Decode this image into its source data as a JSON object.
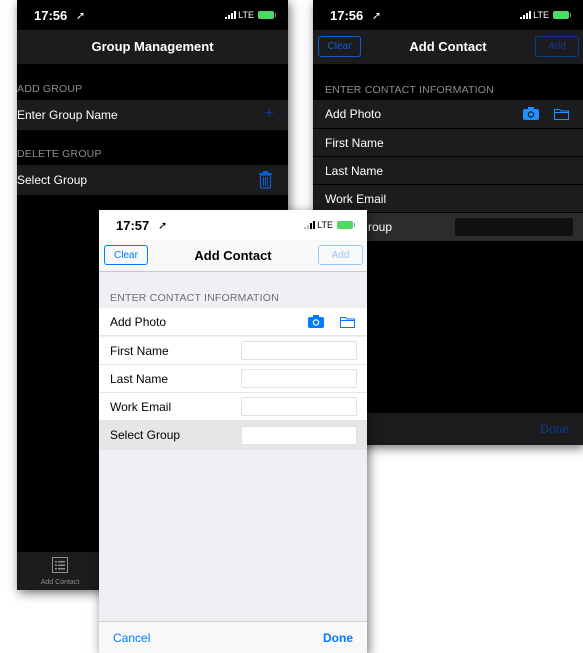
{
  "colors": {
    "accent": "#007aff",
    "dark_bg": "#000000",
    "dark_row": "#1c1c1e",
    "light_bg": "#efeff4"
  },
  "screens": {
    "group_management": {
      "status": {
        "time": "17:56",
        "network": "LTE"
      },
      "title": "Group Management",
      "add_group": {
        "section": "ADD GROUP",
        "placeholder": "Enter Group Name",
        "add_icon": "plus-icon"
      },
      "delete_group": {
        "section": "DELETE GROUP",
        "label": "Select Group",
        "delete_icon": "trash-icon"
      },
      "tab": {
        "label": "Add Contact",
        "icon": "list-icon"
      }
    },
    "add_contact_dark": {
      "status": {
        "time": "17:56",
        "network": "LTE"
      },
      "clear": "Clear",
      "title": "Add Contact",
      "add": "Add",
      "section": "ENTER CONTACT INFORMATION",
      "rows": [
        "Add Photo",
        "First Name",
        "Last Name",
        "Work Email",
        "Select Group"
      ],
      "visible_partial_row": "roup",
      "done": "Done"
    },
    "add_contact_light": {
      "status": {
        "time": "17:57",
        "network": "LTE"
      },
      "clear": "Clear",
      "title": "Add Contact",
      "add": "Add",
      "section": "ENTER CONTACT INFORMATION",
      "rows": [
        "Add Photo",
        "First Name",
        "Last Name",
        "Work Email",
        "Select Group"
      ],
      "cancel": "Cancel",
      "done": "Done"
    }
  }
}
